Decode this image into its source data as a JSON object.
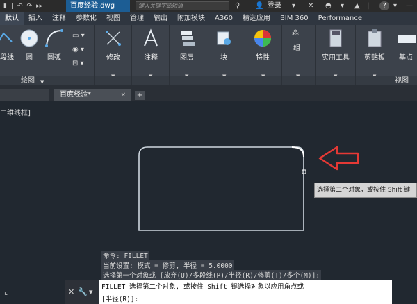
{
  "titlebar": {
    "file_name": "百度经验.dwg",
    "search_placeholder": "键入关键字或短语",
    "login_label": "登录",
    "help_label": "?"
  },
  "ribbon_tabs": [
    {
      "label": "默认",
      "active": true
    },
    {
      "label": "插入"
    },
    {
      "label": "注释"
    },
    {
      "label": "参数化"
    },
    {
      "label": "视图"
    },
    {
      "label": "管理"
    },
    {
      "label": "输出"
    },
    {
      "label": "附加模块"
    },
    {
      "label": "A360"
    },
    {
      "label": "精选应用"
    },
    {
      "label": "BIM 360"
    },
    {
      "label": "Performance"
    }
  ],
  "ribbon": {
    "draw_tools": [
      "段线",
      "圆",
      "圆弧"
    ],
    "draw_section": "绘图",
    "modify": "修改",
    "annotate": "注释",
    "layers": "图层",
    "block": "块",
    "properties": "特性",
    "group": "组",
    "utilities": "实用工具",
    "clipboard": "剪贴板",
    "base": "基点",
    "view_section": "视图"
  },
  "drawing_tab": {
    "label": "百度经验*",
    "close": "×",
    "add": "+"
  },
  "canvas": {
    "view_label": "二维线框]",
    "tooltip": "选择第二个对象，或按住 Shift 键"
  },
  "command": {
    "history": [
      "命令: FILLET",
      "当前设置: 模式 = 修剪, 半径 = 5.0000",
      "选择第一个对象或 [放弃(U)/多段线(P)/半径(R)/修剪(T)/多个(M)]:"
    ],
    "prompt": "FILLET 选择第二个对象, 或按住 Shift 键选择对象以应用角点或",
    "option": "[半径(R)]:"
  },
  "colors": {
    "arrow": "#e53935",
    "accent": "#1c5d94",
    "rectangle": "#cfd8e0"
  }
}
